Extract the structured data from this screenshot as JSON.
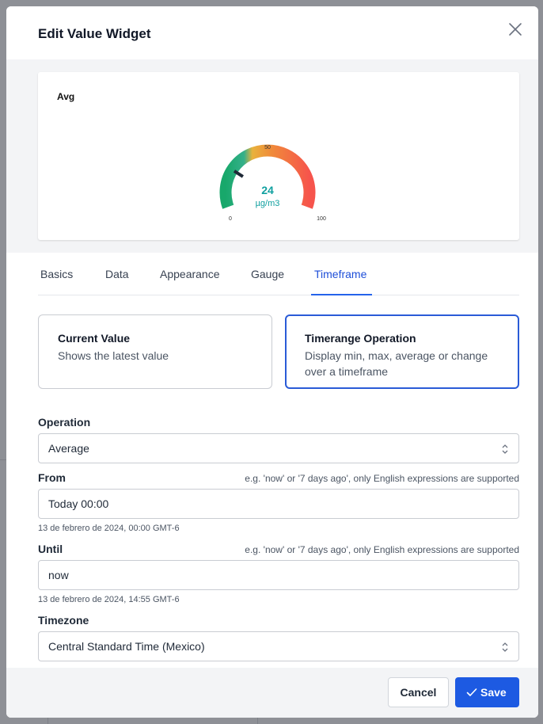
{
  "dialog": {
    "title": "Edit Value Widget"
  },
  "preview": {
    "title": "Avg",
    "gauge": {
      "value": 24,
      "value_text": "24",
      "unit": "µg/m3",
      "min_label": "0",
      "mid_label": "50",
      "max_label": "100",
      "min": 0,
      "max": 100,
      "value_color": "#10a0a0"
    }
  },
  "tabs": [
    {
      "label": "Basics"
    },
    {
      "label": "Data"
    },
    {
      "label": "Appearance"
    },
    {
      "label": "Gauge"
    },
    {
      "label": "Timeframe"
    }
  ],
  "active_tab": "Timeframe",
  "options": {
    "current": {
      "title": "Current Value",
      "desc": "Shows the latest value"
    },
    "timerange": {
      "title": "Timerange Operation",
      "desc": "Display min, max, average or change over a timeframe"
    },
    "selected": "timerange"
  },
  "fields": {
    "operation": {
      "label": "Operation",
      "value": "Average"
    },
    "from": {
      "label": "From",
      "hint": "e.g. 'now' or '7 days ago', only English expressions are supported",
      "value": "Today 00:00",
      "help": "13 de febrero de 2024, 00:00 GMT-6"
    },
    "until": {
      "label": "Until",
      "hint": "e.g. 'now' or '7 days ago', only English expressions are supported",
      "value": "now",
      "help": "13 de febrero de 2024, 14:55 GMT-6"
    },
    "timezone": {
      "label": "Timezone",
      "value": "Central Standard Time (Mexico)"
    }
  },
  "footer": {
    "cancel_label": "Cancel",
    "save_label": "Save"
  },
  "colors": {
    "accent": "#1d5ae2",
    "tab_active": "#1d4ed8"
  }
}
